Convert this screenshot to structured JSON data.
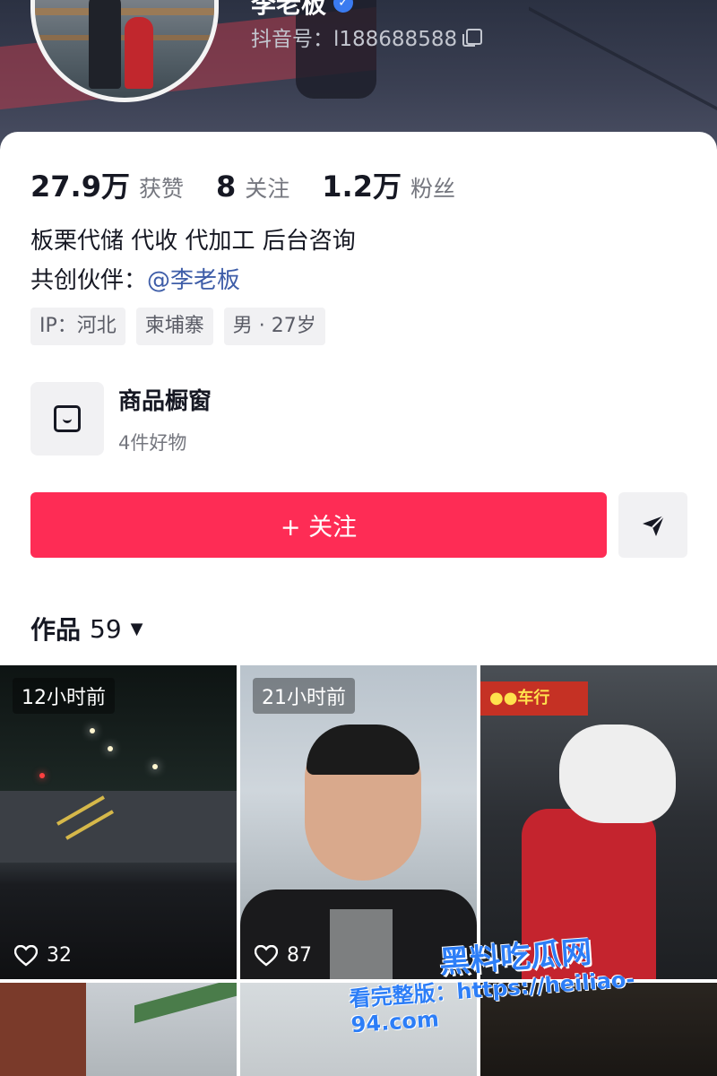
{
  "header": {
    "name": "李老板",
    "douyin_id": "抖音号：l188688588"
  },
  "stats": [
    {
      "value": "27.9万",
      "label": "获赞"
    },
    {
      "value": "8",
      "label": "关注"
    },
    {
      "value": "1.2万",
      "label": "粉丝"
    }
  ],
  "bio": {
    "line1": "板栗代储 代收 代加工 后台咨询",
    "partner_label": "共创伙伴：",
    "partner_mention": "@李老板"
  },
  "tags": [
    "IP：河北",
    "柬埔寨",
    "男 · 27岁"
  ],
  "showcase": {
    "title": "商品橱窗",
    "subtitle": "4件好物"
  },
  "actions": {
    "follow_label": "+ 关注"
  },
  "works": {
    "label": "作品",
    "count": "59"
  },
  "videos": [
    {
      "time": "12小时前",
      "likes": "32"
    },
    {
      "time": "21小时前",
      "likes": "87"
    },
    {
      "time": "",
      "likes": ""
    }
  ],
  "watermark": {
    "brand": "黑料吃瓜网",
    "url_line": "看完整版：https://heiliao-94.com"
  },
  "colors": {
    "accent": "#fe2c55",
    "mention": "#3e5da8",
    "watermark": "#2d7ef7"
  }
}
